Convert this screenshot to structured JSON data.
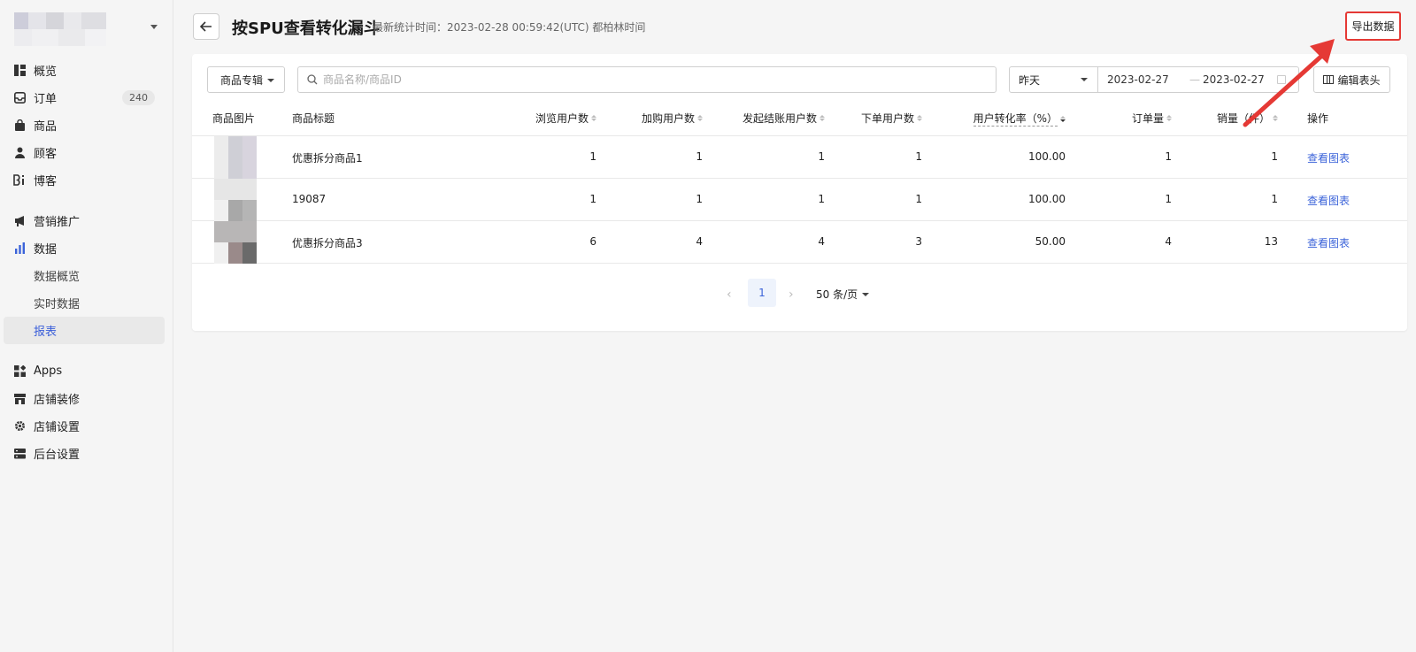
{
  "sidebar": {
    "items": [
      {
        "label": "概览",
        "icon": "overview-icon"
      },
      {
        "label": "订单",
        "icon": "inbox-icon",
        "badge": "240"
      },
      {
        "label": "商品",
        "icon": "bag-icon"
      },
      {
        "label": "顾客",
        "icon": "user-icon"
      },
      {
        "label": "博客",
        "icon": "blog-icon"
      }
    ],
    "items2": [
      {
        "label": "营销推广",
        "icon": "megaphone-icon"
      },
      {
        "label": "数据",
        "icon": "bar-chart-icon"
      }
    ],
    "data_sub": [
      "数据概览",
      "实时数据",
      "报表"
    ],
    "items3": [
      {
        "label": "Apps",
        "icon": "apps-icon"
      },
      {
        "label": "店铺装修",
        "icon": "store-icon"
      },
      {
        "label": "店铺设置",
        "icon": "gear-icon"
      },
      {
        "label": "后台设置",
        "icon": "server-icon"
      }
    ]
  },
  "header": {
    "title": "按SPU查看转化漏斗",
    "stat_time": "最新统计时间：2023-02-28 00:59:42(UTC) 都柏林时间",
    "export_label": "导出数据"
  },
  "filters": {
    "category": "商品专辑",
    "search_placeholder": "商品名称/商品ID",
    "range": "昨天",
    "date_start": "2023-02-27",
    "date_sep": "—",
    "date_end": "2023-02-27",
    "edit_columns": "编辑表头"
  },
  "table": {
    "headers": {
      "image": "商品图片",
      "title": "商品标题",
      "browse": "浏览用户数",
      "cart": "加购用户数",
      "checkout": "发起结账用户数",
      "order_users": "下单用户数",
      "conversion": "用户转化率（%）",
      "orders": "订单量",
      "sales": "销量（件）",
      "action": "操作"
    },
    "rows": [
      {
        "title": "优惠拆分商品1",
        "browse": "1",
        "cart": "1",
        "checkout": "1",
        "order_users": "1",
        "conversion": "100.00",
        "orders": "1",
        "sales": "1",
        "action": "查看图表"
      },
      {
        "title": "19087",
        "browse": "1",
        "cart": "1",
        "checkout": "1",
        "order_users": "1",
        "conversion": "100.00",
        "orders": "1",
        "sales": "1",
        "action": "查看图表"
      },
      {
        "title": "优惠拆分商品3",
        "browse": "6",
        "cart": "4",
        "checkout": "4",
        "order_users": "3",
        "conversion": "50.00",
        "orders": "4",
        "sales": "13",
        "action": "查看图表"
      }
    ]
  },
  "pagination": {
    "current": "1",
    "page_size": "50 条/页"
  },
  "colors": {
    "accent": "#3b63d9",
    "highlight": "#e53935"
  }
}
